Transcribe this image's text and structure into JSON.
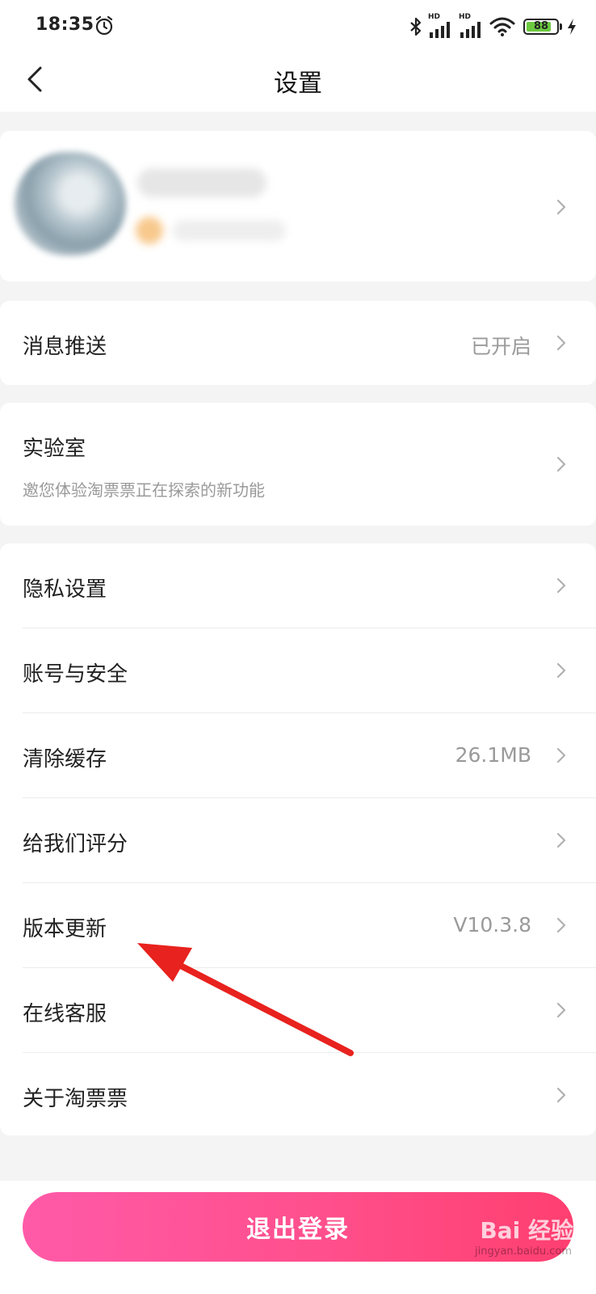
{
  "status_bar": {
    "time": "18:35",
    "battery": "88",
    "signal_label_1": "HD",
    "signal_label_2": "HD"
  },
  "header": {
    "title": "设置"
  },
  "settings": {
    "push": {
      "label": "消息推送",
      "value": "已开启"
    },
    "lab": {
      "label": "实验室",
      "desc": "邀您体验淘票票正在探索的新功能"
    },
    "privacy": {
      "label": "隐私设置"
    },
    "account": {
      "label": "账号与安全"
    },
    "cache": {
      "label": "清除缓存",
      "value": "26.1MB"
    },
    "rate": {
      "label": "给我们评分"
    },
    "version": {
      "label": "版本更新",
      "value": "V10.3.8"
    },
    "service": {
      "label": "在线客服"
    },
    "about": {
      "label": "关于淘票票"
    }
  },
  "logout": {
    "label": "退出登录"
  },
  "watermark": {
    "brand": "Bai 经验",
    "url": "jingyan.baidu.com"
  },
  "colors": {
    "accent_start": "#ff5aa8",
    "accent_end": "#ff3f70",
    "annotation_arrow": "#e8221e"
  }
}
